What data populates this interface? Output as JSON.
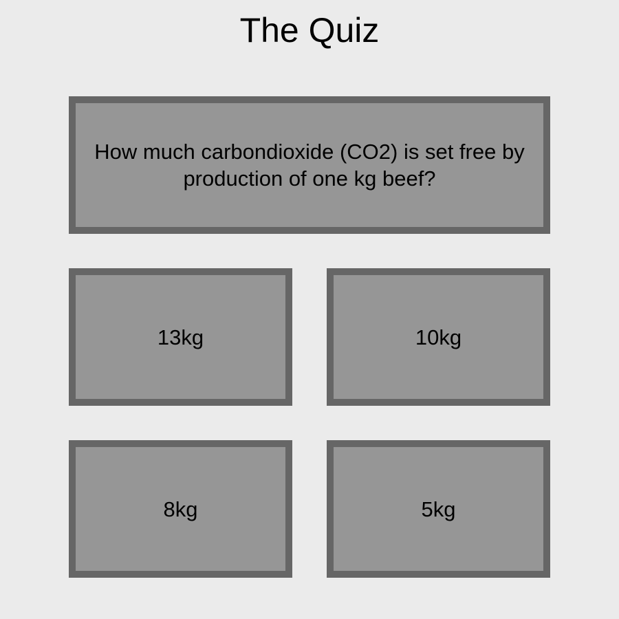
{
  "title": "The Quiz",
  "question": "How much carbondioxide (CO2) is set free by production of one kg beef?",
  "answers": [
    "13kg",
    "10kg",
    "8kg",
    "5kg"
  ],
  "colors": {
    "background": "#ebebeb",
    "box_fill": "#969696",
    "box_border": "#666666"
  }
}
